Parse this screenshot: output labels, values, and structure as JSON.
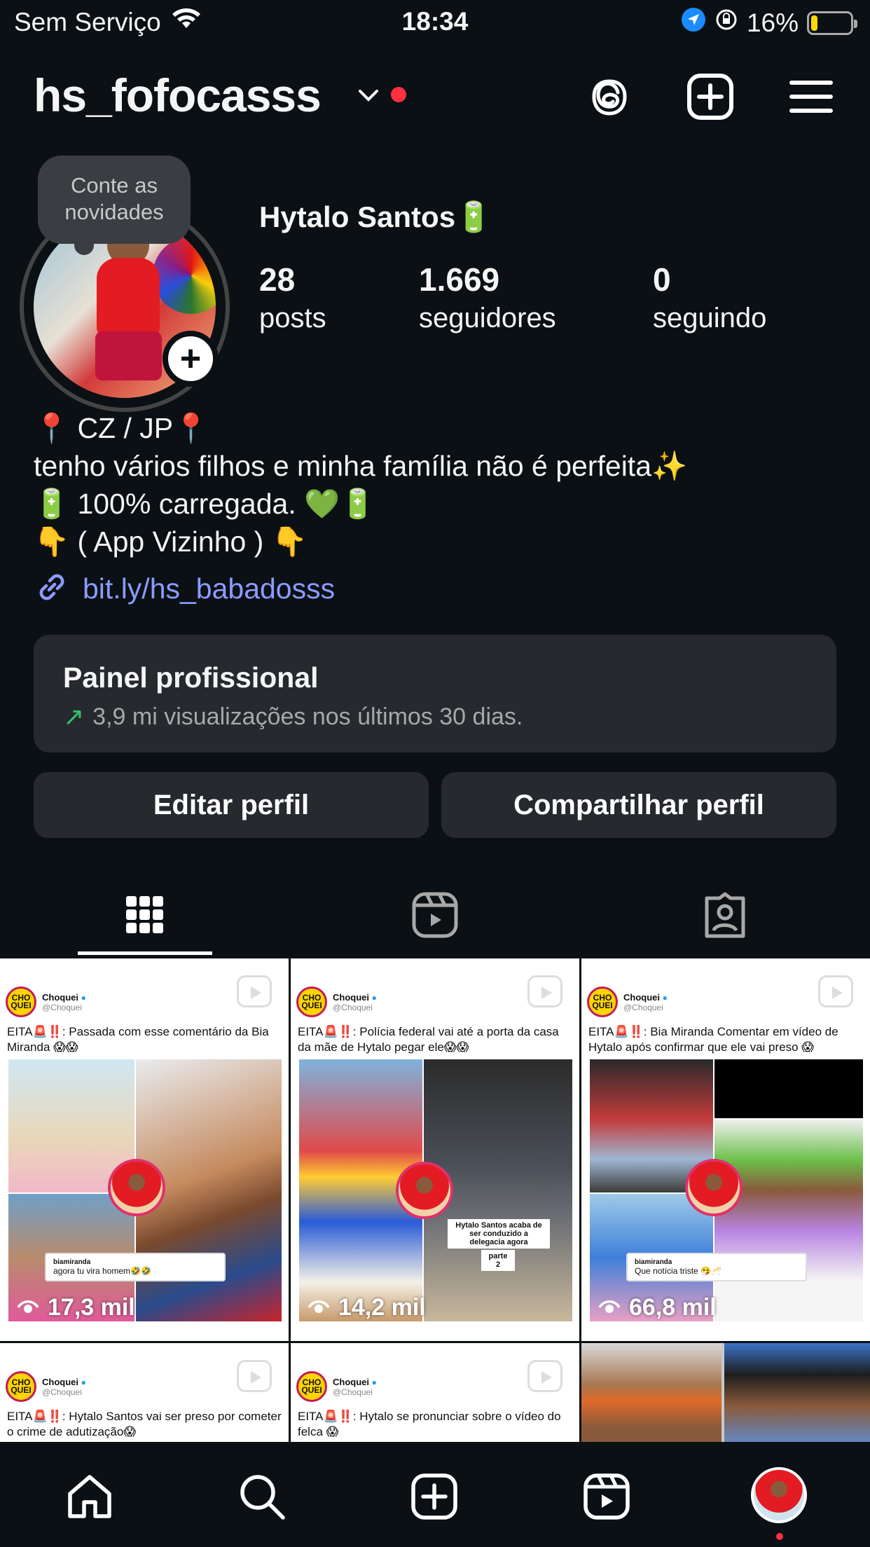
{
  "status_bar": {
    "carrier": "Sem Serviço",
    "time": "18:34",
    "battery_percent": "16%",
    "battery_level": 0.16
  },
  "header": {
    "username": "hs_fofocasss"
  },
  "profile": {
    "note": "Conte as novidades",
    "full_name": "Hytalo Santos🔋",
    "stats": [
      {
        "value": "28",
        "label": "posts"
      },
      {
        "value": "1.669",
        "label": "seguidores"
      },
      {
        "value": "0",
        "label": "seguindo"
      }
    ],
    "bio": [
      "📍 CZ / JP📍",
      "tenho vários filhos e minha família não é perfeita✨",
      "🔋 100% carregada. 💚🔋",
      "👇 ( App Vizinho )  👇"
    ],
    "link": "bit.ly/hs_babadosss"
  },
  "dashboard": {
    "title": "Painel profissional",
    "subtitle": "3,9 mi visualizações nos últimos 30 dias."
  },
  "actions": {
    "edit": "Editar perfil",
    "share": "Compartilhar perfil"
  },
  "tabs": [
    {
      "name": "grid",
      "icon": "grid-icon",
      "active": true
    },
    {
      "name": "reels",
      "icon": "reels-icon",
      "active": false
    },
    {
      "name": "tagged",
      "icon": "tagged-icon",
      "active": false
    }
  ],
  "posts": [
    {
      "author": "Choquei",
      "handle": "@Choquei",
      "caption": "EITA🚨‼️: Passada com esse comentário da Bia Miranda 😱😱",
      "views": "17,3 mil",
      "comment_user": "biamiranda",
      "comment_text": "agora tu vira homem🤣🤣"
    },
    {
      "author": "Choquei",
      "handle": "@Choquei",
      "caption": "EITA🚨‼️: Polícia federal vai até a porta da casa da mãe de Hytalo pegar ele😱😱",
      "views": "14,2 mil",
      "overlay_text": "Hytalo Santos acaba de ser conduzido a delegacia agora",
      "overlay_part": "parte 2"
    },
    {
      "author": "Choquei",
      "handle": "@Choquei",
      "caption": "EITA🚨‼️: Bia Miranda Comentar em vídeo de Hytalo após confirmar que ele vai preso 😱",
      "views": "66,8 mil",
      "comment_user": "biamiranda",
      "comment_text": "Que notícia triste 🤧🥂"
    },
    {
      "author": "Choquei",
      "handle": "@Choquei",
      "caption": "EITA🚨‼️: Hytalo Santos vai ser preso por cometer o crime de adutização😱"
    },
    {
      "author": "Choquei",
      "handle": "@Choquei",
      "caption": "EITA🚨‼️: Hytalo se pronunciar sobre o vídeo do felca 😱"
    }
  ],
  "colors": {
    "background": "#0b1014",
    "card": "#26292e",
    "link": "#8c9bff",
    "notification": "#ff3040",
    "trend_up": "#33c26b"
  }
}
